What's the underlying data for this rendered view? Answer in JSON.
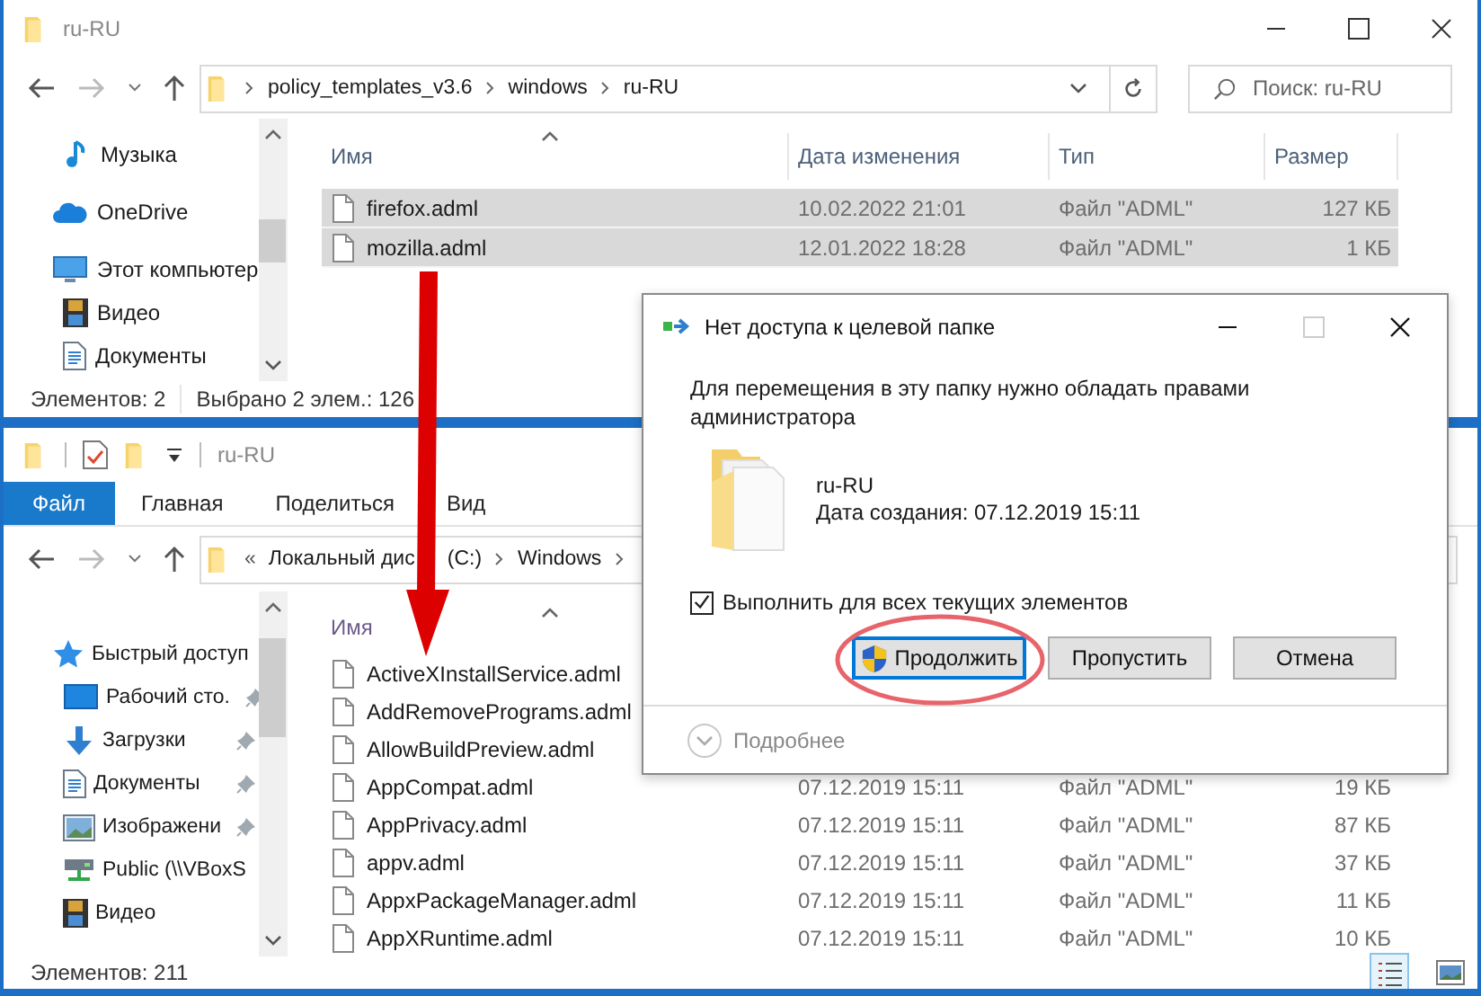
{
  "top_window": {
    "title": "ru-RU",
    "address": {
      "crumbs": [
        "policy_templates_v3.6",
        "windows",
        "ru-RU"
      ]
    },
    "search": {
      "placeholder": "Поиск: ru-RU"
    },
    "nav": [
      {
        "children": [
          {
            "label": "Музыка",
            "kind": "music",
            "pinned": false
          }
        ]
      },
      {
        "label": "OneDrive",
        "kind": "cloud",
        "pinned": false
      },
      {
        "label": "Этот компьютер",
        "kind": "computer",
        "pinned": false,
        "children": [
          {
            "label": "Видео",
            "kind": "video",
            "pinned": false
          },
          {
            "label": "Документы",
            "kind": "document",
            "pinned": false
          }
        ]
      }
    ],
    "columns": [
      "Имя",
      "Дата изменения",
      "Тип",
      "Размер"
    ],
    "rows": [
      {
        "name": "firefox.adml",
        "date": "10.02.2022 21:01",
        "type": "Файл \"ADML\"",
        "size": "127 КБ",
        "selected": true
      },
      {
        "name": "mozilla.adml",
        "date": "12.01.2022 18:28",
        "type": "Файл \"ADML\"",
        "size": "1 КБ",
        "selected": true
      }
    ],
    "status": [
      "Элементов: 2",
      "Выбрано 2 элем.: 126"
    ]
  },
  "bottom_window": {
    "title": "ru-RU",
    "ribbon_tabs": [
      {
        "label": "Файл",
        "selected": true
      },
      {
        "label": "Главная",
        "selected": false
      },
      {
        "label": "Поделиться",
        "selected": false
      },
      {
        "label": "Вид",
        "selected": false
      }
    ],
    "address": {
      "overflow": "«",
      "crumbs": [
        [
          "Локальный дис",
          "(C:)"
        ],
        "Windows"
      ]
    },
    "nav": [
      {
        "label": "Быстрый доступ",
        "kind": "star",
        "pinned": false,
        "children": [
          {
            "label": "Рабочий сто.",
            "kind": "desktop",
            "pinned": true
          },
          {
            "label": "Загрузки",
            "kind": "download",
            "pinned": true
          },
          {
            "label": "Документы",
            "kind": "document",
            "pinned": true
          },
          {
            "label": "Изображени",
            "kind": "image",
            "pinned": true
          },
          {
            "label": "Public (\\\\VBoxS",
            "kind": "network",
            "pinned": false
          },
          {
            "label": "Видео",
            "kind": "video",
            "pinned": false
          }
        ]
      }
    ],
    "columns": [
      "Имя"
    ],
    "rows": [
      {
        "name": "ActiveXInstallService.adml",
        "selected": false
      },
      {
        "name": "AddRemovePrograms.adml",
        "selected": false
      },
      {
        "name": "AllowBuildPreview.adml",
        "selected": false
      },
      {
        "name": "AppCompat.adml",
        "date": "07.12.2019 15:11",
        "type": "Файл \"ADML\"",
        "size": "19 КБ",
        "selected": false
      },
      {
        "name": "AppPrivacy.adml",
        "date": "07.12.2019 15:11",
        "type": "Файл \"ADML\"",
        "size": "87 КБ",
        "selected": false
      },
      {
        "name": "appv.adml",
        "date": "07.12.2019 15:11",
        "type": "Файл \"ADML\"",
        "size": "37 КБ",
        "selected": false
      },
      {
        "name": "AppxPackageManager.adml",
        "date": "07.12.2019 15:11",
        "type": "Файл \"ADML\"",
        "size": "11 КБ",
        "selected": false
      },
      {
        "name": "AppXRuntime.adml",
        "date": "07.12.2019 15:11",
        "type": "Файл \"ADML\"",
        "size": "10 КБ",
        "selected": false
      }
    ],
    "status": [
      "Элементов: 211"
    ],
    "views": [
      {
        "kind": "details",
        "selected": true
      },
      {
        "kind": "preview",
        "selected": false
      }
    ]
  },
  "dialog": {
    "title": "Нет доступа к целевой папке",
    "message": "Для перемещения в эту папку нужно обладать правами администратора",
    "item_name": "ru-RU",
    "item_date": "Дата создания: 07.12.2019 15:11",
    "apply_all": {
      "label": "Выполнить для всех текущих элементов",
      "checked": true
    },
    "buttons": [
      {
        "label": "Продолжить",
        "shield": true,
        "focused": true,
        "highlighted": true
      },
      {
        "label": "Пропустить",
        "shield": false,
        "focused": false,
        "highlighted": false
      },
      {
        "label": "Отмена",
        "shield": false,
        "focused": false,
        "highlighted": false
      }
    ],
    "details": "Подробнее"
  }
}
